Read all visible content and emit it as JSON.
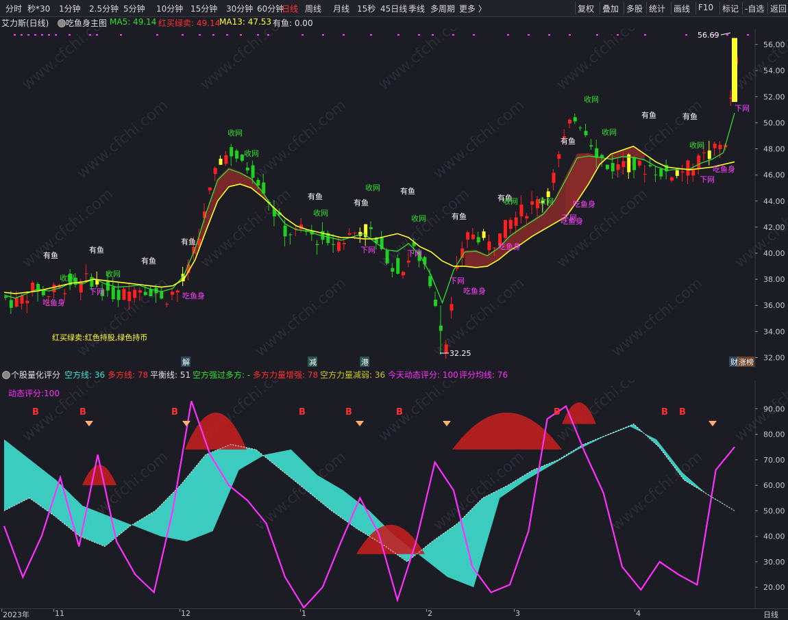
{
  "toolbar": {
    "left_items": [
      "分时",
      "秒*30",
      "1分钟",
      "2.5分钟",
      "5分钟",
      "10分钟",
      "15分钟",
      "30分钟",
      "60分钟",
      "日线",
      "周线",
      "月线",
      "15秒",
      "45日线",
      "季线",
      "多周期",
      "更多 〉"
    ],
    "active": "日线",
    "right_items": [
      "复权",
      "叠加",
      "多股",
      "统计",
      "画线",
      "F10",
      "标记",
      "-自选",
      "返回"
    ]
  },
  "main": {
    "stock": "艾力斯(日线)",
    "indicator": "吃鱼身主图",
    "ma5_label": "MA5: 49.14",
    "red_label": "红买绿卖: 49.14",
    "ma13_label": "MA13: 47.53",
    "fish_label": "有鱼: 0.00",
    "legend_note": "红买绿卖:红色持股,绿色持币",
    "high_label": "56.69",
    "low_label": "32.25",
    "y_ticks": [
      "56.00",
      "54.00",
      "52.00",
      "50.00",
      "48.00",
      "46.00",
      "44.00",
      "42.00",
      "40.00",
      "38.00",
      "36.00",
      "34.00",
      "32.00"
    ],
    "annotations": [
      {
        "text": "有鱼",
        "kind": "fish",
        "n": 1
      },
      {
        "text": "收网",
        "kind": "close",
        "n": 1
      },
      {
        "text": "下网",
        "kind": "net",
        "n": 1
      },
      {
        "text": "吃鱼身",
        "kind": "eat",
        "n": 1
      }
    ],
    "bottom_tags": [
      "解",
      "减",
      "港",
      "财",
      "涨榜"
    ]
  },
  "sub": {
    "title": "个股量化评分",
    "air": "空方线: 36",
    "bull": "多方线: 78",
    "balance": "平衡线: 51",
    "cross": "空方强过多方: -",
    "bull_power": "多方力量增强: 78",
    "bear_power": "空方力量减弱: 36",
    "today": "今天动态评分: 100",
    "avg": "评分均线: 76",
    "dyn_label": "动态评分:100",
    "buy_mark": "B",
    "y_ticks": [
      "90.00",
      "80.00",
      "70.00",
      "60.00",
      "50.00",
      "40.00",
      "30.00",
      "20.00"
    ]
  },
  "xaxis": {
    "labels": [
      "2023年",
      "11",
      "12",
      "1",
      "2",
      "3",
      "4"
    ],
    "right_label": "日线"
  },
  "watermark": "www.cfchi.com",
  "colors": {
    "up": "#ff2020",
    "down": "#20d020",
    "ma5": "#30e030",
    "ma13": "#ffff30",
    "score": "#ff30ff",
    "cyan": "#40e0d0",
    "band": "#c02020"
  },
  "chart_data": {
    "type": "candlestick",
    "title": "艾力斯(日线)",
    "ylim": [
      31.5,
      57
    ],
    "price_path": [
      36.6,
      36.2,
      36.8,
      37.4,
      36.9,
      37.2,
      37.8,
      37.5,
      38.1,
      37.4,
      37.0,
      36.8,
      37.2,
      37.5,
      37.0,
      36.7,
      37.1,
      38.6,
      41.2,
      44.5,
      47.2,
      47.8,
      47.0,
      46.4,
      45.1,
      43.2,
      41.8,
      41.5,
      41.6,
      41.2,
      41.0,
      40.8,
      41.3,
      41.9,
      41.5,
      40.6,
      39.2,
      38.8,
      40.3,
      39.2,
      36.5,
      33.0,
      38.4,
      41.2,
      41.4,
      40.6,
      41.3,
      42.4,
      43.1,
      43.6,
      44.2,
      45.8,
      48.5,
      50.6,
      49.6,
      47.9,
      46.8,
      46.6,
      46.9,
      46.5,
      46.7,
      46.3,
      46.1,
      46.4,
      46.5,
      47.3,
      47.8,
      48.6,
      54.5
    ],
    "ma_yellow": [
      37.0,
      36.9,
      37.0,
      37.1,
      37.3,
      37.5,
      37.7,
      37.8,
      38.0,
      37.9,
      37.8,
      37.7,
      37.6,
      37.5,
      37.4,
      37.5,
      38.0,
      39.5,
      41.8,
      44.0,
      45.1,
      45.3,
      45.0,
      44.3,
      43.5,
      42.7,
      42.1,
      41.8,
      41.6,
      41.4,
      41.2,
      41.2,
      41.1,
      41.1,
      41.3,
      41.5,
      41.2,
      40.5,
      40.1,
      39.4,
      39.0,
      39.0,
      38.9,
      39.0,
      39.5,
      40.2,
      40.7,
      41.3,
      41.8,
      42.3,
      42.8,
      44.0,
      45.3,
      46.8,
      47.6,
      47.9,
      48.2,
      47.6,
      47.0,
      46.6,
      46.5,
      46.4,
      46.5,
      46.6,
      46.8,
      47.0
    ],
    "score_path": [
      44,
      24,
      40,
      63,
      36,
      72,
      38,
      25,
      18,
      50,
      93,
      72,
      60,
      54,
      45,
      24,
      12,
      20,
      38,
      55,
      41,
      15,
      38,
      69,
      58,
      28,
      18,
      21,
      42,
      86,
      91,
      73,
      57,
      28,
      19,
      30,
      25,
      21,
      66,
      75
    ],
    "bull_path": [
      78,
      70,
      62,
      52,
      48,
      44,
      40,
      38,
      42,
      66,
      72,
      74,
      64,
      58,
      50,
      40,
      32,
      24,
      20,
      55,
      62,
      68,
      74,
      79,
      83,
      78,
      65,
      56,
      50
    ],
    "bear_path": [
      50,
      55,
      48,
      40,
      36,
      44,
      50,
      60,
      72,
      76,
      74,
      66,
      58,
      50,
      43,
      37,
      30,
      38,
      45,
      55,
      60,
      66,
      70,
      76,
      80,
      84,
      75,
      62,
      56,
      50
    ]
  }
}
